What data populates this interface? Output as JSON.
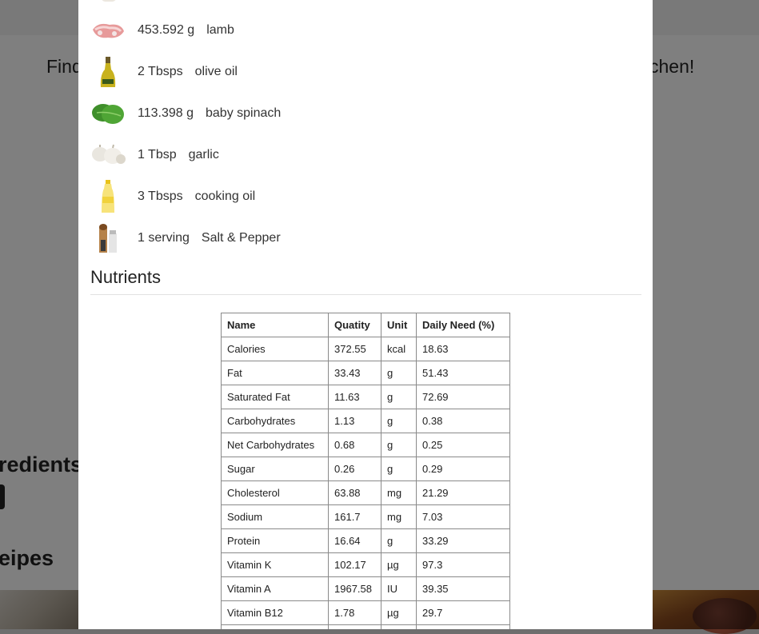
{
  "background": {
    "tagline_left": "Find",
    "tagline_right": "chen!",
    "ingredients_heading": "redients",
    "recipes_heading": "eipes"
  },
  "ingredients": [
    {
      "amount": "453.592 g",
      "name": "lamb",
      "icon": "lamb-icon"
    },
    {
      "amount": "2 Tbsps",
      "name": "olive oil",
      "icon": "olive-oil-bottle-icon"
    },
    {
      "amount": "113.398 g",
      "name": "baby spinach",
      "icon": "spinach-icon"
    },
    {
      "amount": "1 Tbsp",
      "name": "garlic",
      "icon": "garlic-icon"
    },
    {
      "amount": "3 Tbsps",
      "name": "cooking oil",
      "icon": "cooking-oil-bottle-icon"
    },
    {
      "amount": "1 serving",
      "name": "Salt & Pepper",
      "icon": "salt-pepper-icon"
    }
  ],
  "nutrients": {
    "title": "Nutrients",
    "headers": [
      "Name",
      "Quatity",
      "Unit",
      "Daily Need (%)"
    ],
    "rows": [
      [
        "Calories",
        "372.55",
        "kcal",
        "18.63"
      ],
      [
        "Fat",
        "33.43",
        "g",
        "51.43"
      ],
      [
        "Saturated Fat",
        "11.63",
        "g",
        "72.69"
      ],
      [
        "Carbohydrates",
        "1.13",
        "g",
        "0.38"
      ],
      [
        "Net Carbohydrates",
        "0.68",
        "g",
        "0.25"
      ],
      [
        "Sugar",
        "0.26",
        "g",
        "0.29"
      ],
      [
        "Cholesterol",
        "63.88",
        "mg",
        "21.29"
      ],
      [
        "Sodium",
        "161.7",
        "mg",
        "7.03"
      ],
      [
        "Protein",
        "16.64",
        "g",
        "33.29"
      ],
      [
        "Vitamin K",
        "102.17",
        "µg",
        "97.3"
      ],
      [
        "Vitamin A",
        "1967.58",
        "IU",
        "39.35"
      ],
      [
        "Vitamin B12",
        "1.78",
        "µg",
        "29.7"
      ],
      [
        "",
        "",
        "",
        ""
      ]
    ]
  }
}
